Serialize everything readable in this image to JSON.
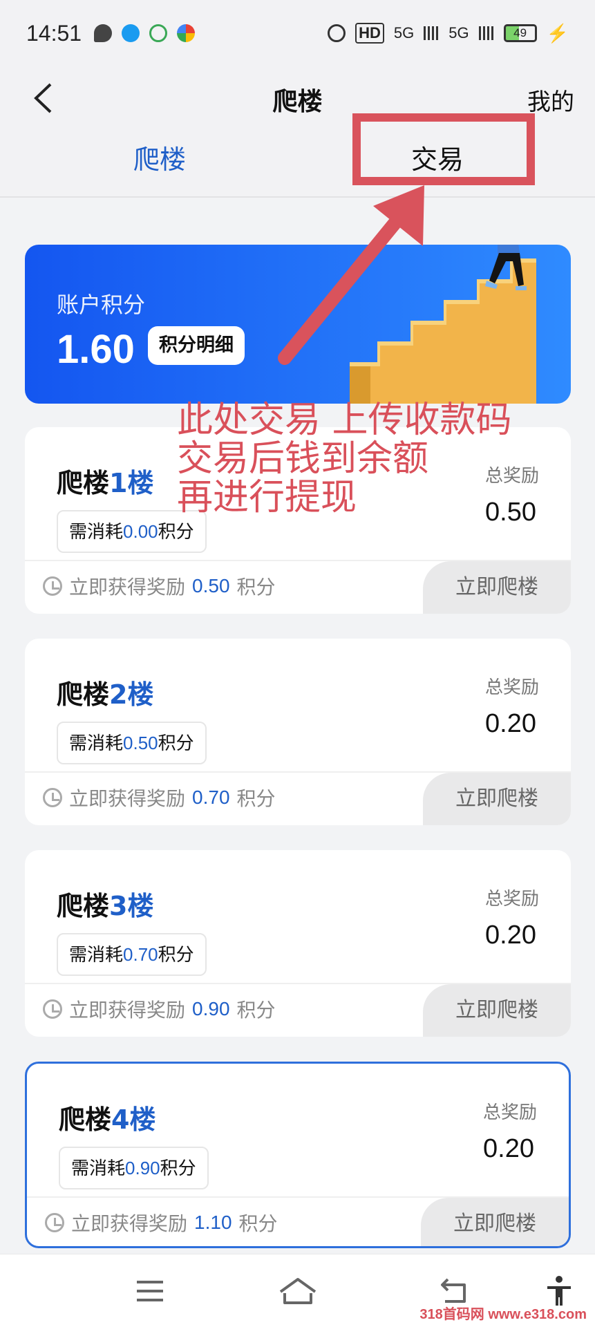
{
  "status_bar": {
    "time": "14:51",
    "network_left": "HD",
    "network_1": "5G",
    "network_2": "5G",
    "battery": "49"
  },
  "nav": {
    "title": "爬楼",
    "right_link": "我的"
  },
  "tabs": [
    {
      "label": "爬楼",
      "active": true
    },
    {
      "label": "交易",
      "active": false
    }
  ],
  "points": {
    "label": "账户积分",
    "value": "1.60",
    "detail_button": "积分明细"
  },
  "annotation": {
    "text": "此处交易 上传收款码\n交易后钱到余额\n再进行提现",
    "color": "#d9505a"
  },
  "floors": [
    {
      "title_prefix": "爬楼",
      "number": "1",
      "title_suffix": "楼",
      "cost_label": "需消耗",
      "cost": "0.00",
      "cost_unit": "积分",
      "total_label": "总奖励",
      "total": "0.50",
      "reward_label": "立即获得奖励",
      "reward": "0.50",
      "reward_unit": "积分",
      "button": "立即爬楼"
    },
    {
      "title_prefix": "爬楼",
      "number": "2",
      "title_suffix": "楼",
      "cost_label": "需消耗",
      "cost": "0.50",
      "cost_unit": "积分",
      "total_label": "总奖励",
      "total": "0.20",
      "reward_label": "立即获得奖励",
      "reward": "0.70",
      "reward_unit": "积分",
      "button": "立即爬楼"
    },
    {
      "title_prefix": "爬楼",
      "number": "3",
      "title_suffix": "楼",
      "cost_label": "需消耗",
      "cost": "0.70",
      "cost_unit": "积分",
      "total_label": "总奖励",
      "total": "0.20",
      "reward_label": "立即获得奖励",
      "reward": "0.90",
      "reward_unit": "积分",
      "button": "立即爬楼"
    },
    {
      "title_prefix": "爬楼",
      "number": "4",
      "title_suffix": "楼",
      "cost_label": "需消耗",
      "cost": "0.90",
      "cost_unit": "积分",
      "total_label": "总奖励",
      "total": "0.20",
      "reward_label": "立即获得奖励",
      "reward": "1.10",
      "reward_unit": "积分",
      "button": "立即爬楼"
    }
  ],
  "watermark": "318首码网 www.e318.com",
  "colors": {
    "accent": "#1f5fc8",
    "card_gradient_start": "#1456f0",
    "card_gradient_end": "#2f8bff",
    "annotation": "#d9535c"
  }
}
